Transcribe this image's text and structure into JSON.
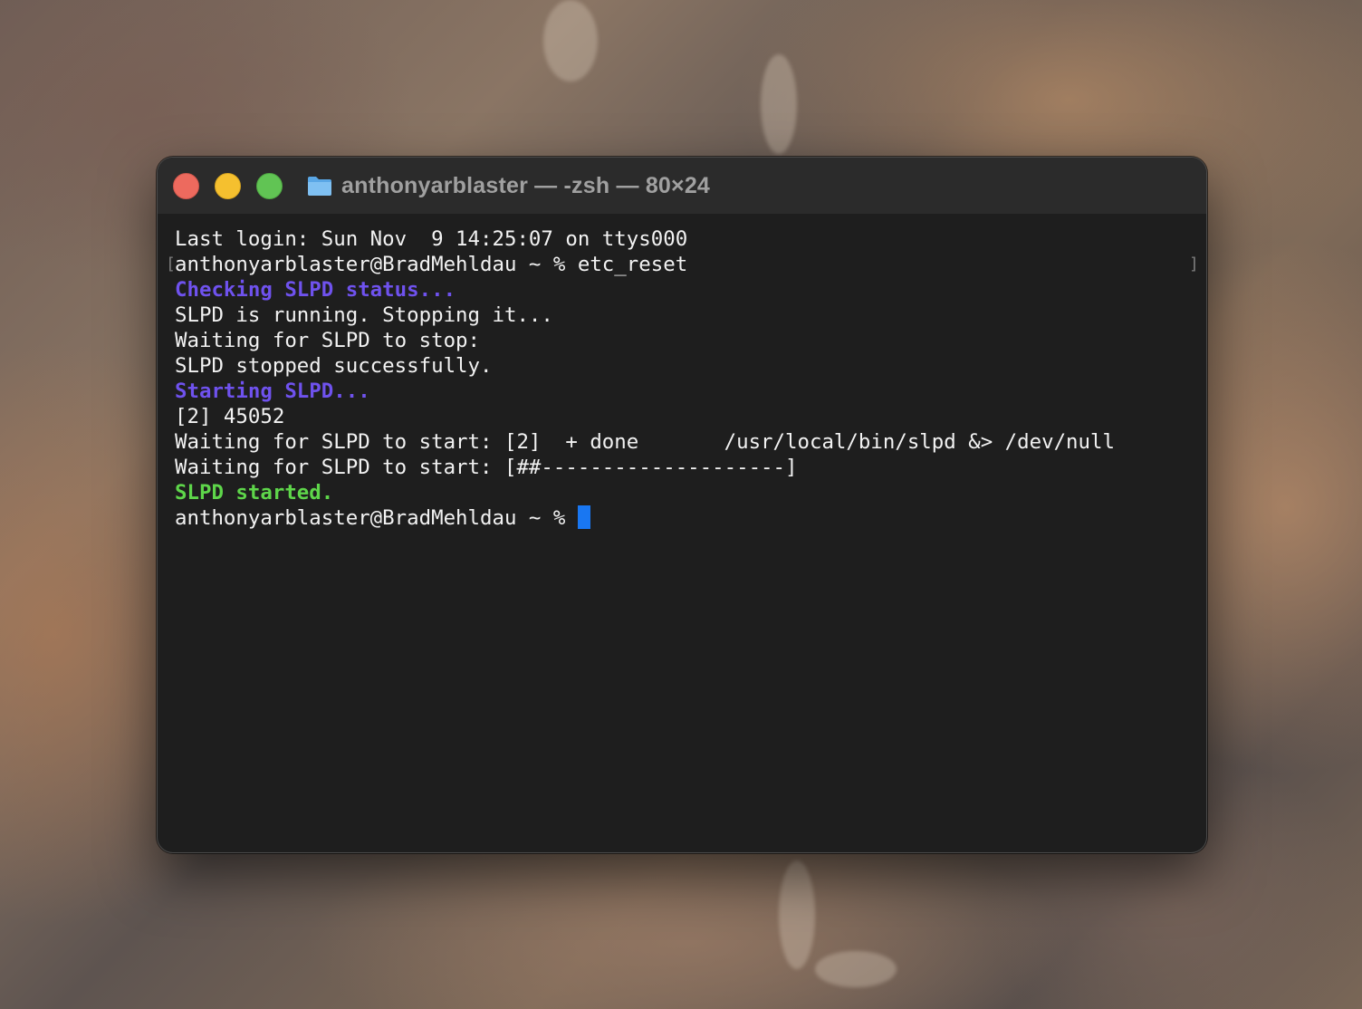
{
  "window": {
    "title": "anthonyarblaster — -zsh — 80×24",
    "title_icon": "folder-icon",
    "buttons": {
      "close": "close-button",
      "minimize": "minimize-button",
      "zoom": "zoom-button"
    }
  },
  "colors": {
    "terminal_bg": "#1e1e1e",
    "titlebar_bg": "#2b2b2b",
    "text": "#f2f2f2",
    "purple": "#6f52ee",
    "green": "#5ed64a",
    "cursor": "#1977f2"
  },
  "terminal": {
    "lines": [
      {
        "text": "Last login: Sun Nov  9 14:25:07 on ttys000",
        "style": "normal"
      },
      {
        "text": "anthonyarblaster@BradMehldau ~ % etc_reset",
        "style": "normal",
        "marked": true
      },
      {
        "text": "Checking SLPD status...",
        "style": "purple"
      },
      {
        "text": "SLPD is running. Stopping it...",
        "style": "normal"
      },
      {
        "text": "Waiting for SLPD to stop:",
        "style": "normal"
      },
      {
        "text": "SLPD stopped successfully.",
        "style": "normal"
      },
      {
        "text": "Starting SLPD...",
        "style": "purple"
      },
      {
        "text": "[2] 45052",
        "style": "normal"
      },
      {
        "text": "Waiting for SLPD to start: [2]  + done       /usr/local/bin/slpd &> /dev/null",
        "style": "normal"
      },
      {
        "text": "Waiting for SLPD to start: [##--------------------]",
        "style": "normal"
      },
      {
        "text": "SLPD started.",
        "style": "green"
      }
    ],
    "prompt": "anthonyarblaster@BradMehldau ~ % "
  }
}
